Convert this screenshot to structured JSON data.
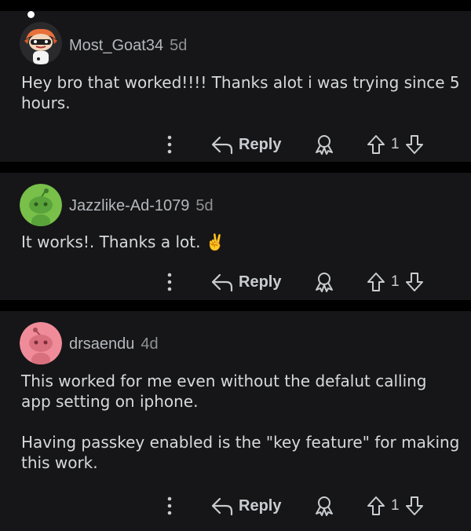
{
  "comments": [
    {
      "author": "Most_Goat34",
      "age": "5d",
      "paragraphs": [
        "Hey bro that worked!!!! Thanks alot i was trying since 5 hours."
      ],
      "reply_label": "Reply",
      "votes": "1",
      "avatar_icon": "goat-snoo-avatar"
    },
    {
      "author": "Jazzlike-Ad-1079",
      "age": "5d",
      "paragraphs": [
        "It works!. Thanks a lot. ✌️"
      ],
      "reply_label": "Reply",
      "votes": "1",
      "avatar_icon": "green-snoo-avatar"
    },
    {
      "author": "drsaendu",
      "age": "4d",
      "paragraphs": [
        "This worked for me even without the defalut calling app setting on iphone.",
        "Having passkey enabled is the \"key feature\" for making this work."
      ],
      "reply_label": "Reply",
      "votes": "1",
      "avatar_icon": "pink-snoo-avatar"
    }
  ],
  "colors": {
    "background": "#000000",
    "card": "#161618",
    "text": "#d7dadc",
    "muted": "#8e9296",
    "avatar_green": "#78c04a",
    "avatar_pink": "#f08c9a",
    "avatar_orange": "#e8703a"
  },
  "icons": [
    "more-vertical-icon",
    "reply-arrow-icon",
    "award-icon",
    "upvote-icon",
    "downvote-icon"
  ]
}
